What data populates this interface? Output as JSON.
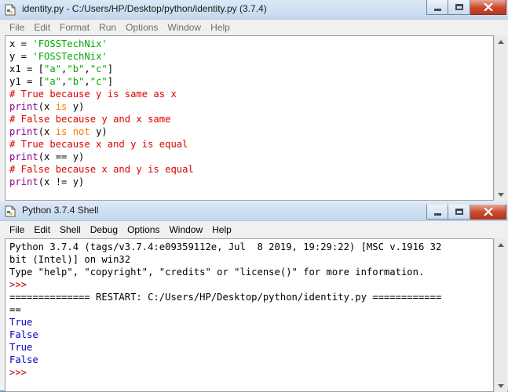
{
  "editor": {
    "title": "identity.py - C:/Users/HP/Desktop/python/identity.py (3.7.4)",
    "menu": [
      "File",
      "Edit",
      "Format",
      "Run",
      "Options",
      "Window",
      "Help"
    ],
    "lines": [
      [
        {
          "t": "x = "
        },
        {
          "t": "'FOSSTechNix'",
          "c": "str"
        }
      ],
      [
        {
          "t": "y = "
        },
        {
          "t": "'FOSSTechNix'",
          "c": "str"
        }
      ],
      [
        {
          "t": "x1 = ["
        },
        {
          "t": "\"a\"",
          "c": "str"
        },
        {
          "t": ","
        },
        {
          "t": "\"b\"",
          "c": "str"
        },
        {
          "t": ","
        },
        {
          "t": "\"c\"",
          "c": "str"
        },
        {
          "t": "]"
        }
      ],
      [
        {
          "t": "y1 = ["
        },
        {
          "t": "\"a\"",
          "c": "str"
        },
        {
          "t": ","
        },
        {
          "t": "\"b\"",
          "c": "str"
        },
        {
          "t": ","
        },
        {
          "t": "\"c\"",
          "c": "str"
        },
        {
          "t": "]"
        }
      ],
      [
        {
          "t": "# True because y is same as x",
          "c": "com"
        }
      ],
      [
        {
          "t": "print",
          "c": "bi"
        },
        {
          "t": "(x "
        },
        {
          "t": "is",
          "c": "kw"
        },
        {
          "t": " y)"
        }
      ],
      [
        {
          "t": "# False because y and x same",
          "c": "com"
        }
      ],
      [
        {
          "t": "print",
          "c": "bi"
        },
        {
          "t": "(x "
        },
        {
          "t": "is not",
          "c": "kw"
        },
        {
          "t": " y)"
        }
      ],
      [
        {
          "t": "# True because x and y is equal",
          "c": "com"
        }
      ],
      [
        {
          "t": "print",
          "c": "bi"
        },
        {
          "t": "(x == y)"
        }
      ],
      [
        {
          "t": "# False because x and y is equal",
          "c": "com"
        }
      ],
      [
        {
          "t": "print",
          "c": "bi"
        },
        {
          "t": "(x != y)"
        }
      ]
    ]
  },
  "shell": {
    "title": "Python 3.7.4 Shell",
    "menu": [
      "File",
      "Edit",
      "Shell",
      "Debug",
      "Options",
      "Window",
      "Help"
    ],
    "lines": [
      [
        {
          "t": "Python 3.7.4 (tags/v3.7.4:e09359112e, Jul  8 2019, 19:29:22) [MSC v.1916 32"
        }
      ],
      [
        {
          "t": "bit (Intel)] on win32"
        }
      ],
      [
        {
          "t": "Type \"help\", \"copyright\", \"credits\" or \"license()\" for more information."
        }
      ],
      [
        {
          "t": ">>> ",
          "c": "prompt"
        }
      ],
      [
        {
          "t": "============== RESTART: C:/Users/HP/Desktop/python/identity.py ============"
        }
      ],
      [
        {
          "t": "=="
        }
      ],
      [
        {
          "t": "True",
          "c": "out"
        }
      ],
      [
        {
          "t": "False",
          "c": "out"
        }
      ],
      [
        {
          "t": "True",
          "c": "out"
        }
      ],
      [
        {
          "t": "False",
          "c": "out"
        }
      ],
      [
        {
          "t": ">>> ",
          "c": "prompt"
        }
      ]
    ]
  }
}
